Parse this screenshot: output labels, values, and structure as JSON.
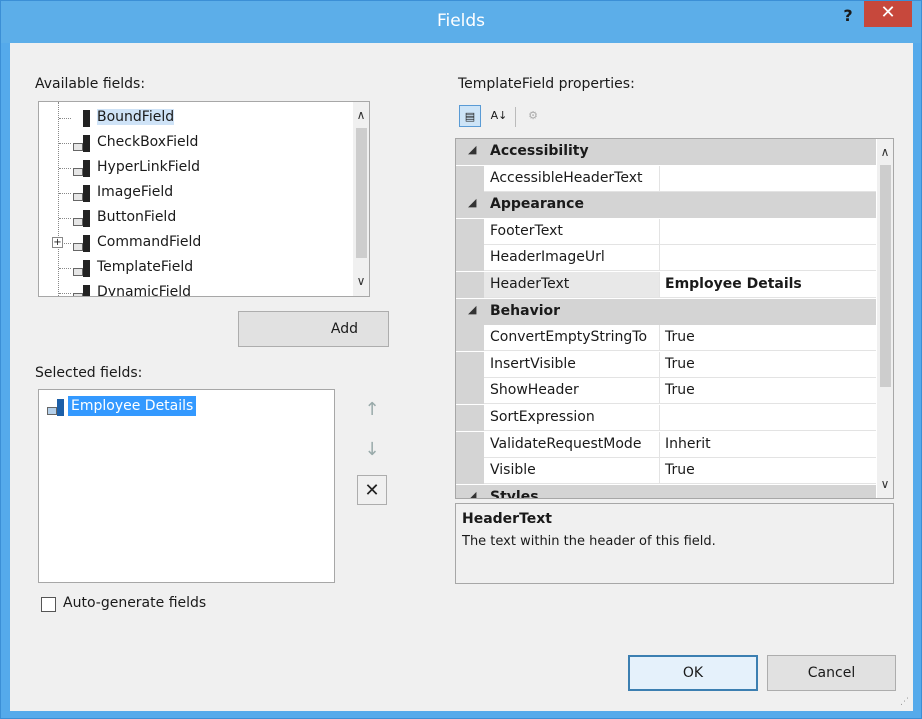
{
  "window": {
    "title": "Fields",
    "help_label": "?",
    "close_label": "✕"
  },
  "available_fields": {
    "label": "Available fields:",
    "items": [
      {
        "label": "BoundField",
        "icon": "bound-field-icon"
      },
      {
        "label": "CheckBoxField",
        "icon": "checkbox-field-icon"
      },
      {
        "label": "HyperLinkField",
        "icon": "hyperlink-field-icon"
      },
      {
        "label": "ImageField",
        "icon": "image-field-icon"
      },
      {
        "label": "ButtonField",
        "icon": "button-field-icon"
      },
      {
        "label": "CommandField",
        "icon": "command-field-icon",
        "expand": "+"
      },
      {
        "label": "TemplateField",
        "icon": "template-field-icon"
      },
      {
        "label": "DynamicField",
        "icon": "dynamic-field-icon"
      }
    ]
  },
  "add_button": {
    "label": "Add"
  },
  "selected_fields": {
    "label": "Selected fields:",
    "items": [
      {
        "label": "Employee Details"
      }
    ]
  },
  "move_buttons": {
    "up": "↑",
    "down": "↓",
    "delete": "✕"
  },
  "auto_generate": {
    "label": "Auto-generate fields",
    "checked": false
  },
  "properties": {
    "label": "TemplateField properties:",
    "rows": [
      {
        "type": "category",
        "name": "Accessibility"
      },
      {
        "type": "prop",
        "name": "AccessibleHeaderText",
        "value": ""
      },
      {
        "type": "category",
        "name": "Appearance"
      },
      {
        "type": "prop",
        "name": "FooterText",
        "value": ""
      },
      {
        "type": "prop",
        "name": "HeaderImageUrl",
        "value": ""
      },
      {
        "type": "prop",
        "name": "HeaderText",
        "value": "Employee Details",
        "selected": true
      },
      {
        "type": "category",
        "name": "Behavior"
      },
      {
        "type": "prop",
        "name": "ConvertEmptyStringTo",
        "value": "True"
      },
      {
        "type": "prop",
        "name": "InsertVisible",
        "value": "True"
      },
      {
        "type": "prop",
        "name": "ShowHeader",
        "value": "True"
      },
      {
        "type": "prop",
        "name": "SortExpression",
        "value": ""
      },
      {
        "type": "prop",
        "name": "ValidateRequestMode",
        "value": "Inherit"
      },
      {
        "type": "prop",
        "name": "Visible",
        "value": "True"
      },
      {
        "type": "category",
        "name": "Styles"
      }
    ],
    "description": {
      "title": "HeaderText",
      "text": "The text within the header of this field."
    }
  },
  "footer": {
    "ok": "OK",
    "cancel": "Cancel"
  }
}
